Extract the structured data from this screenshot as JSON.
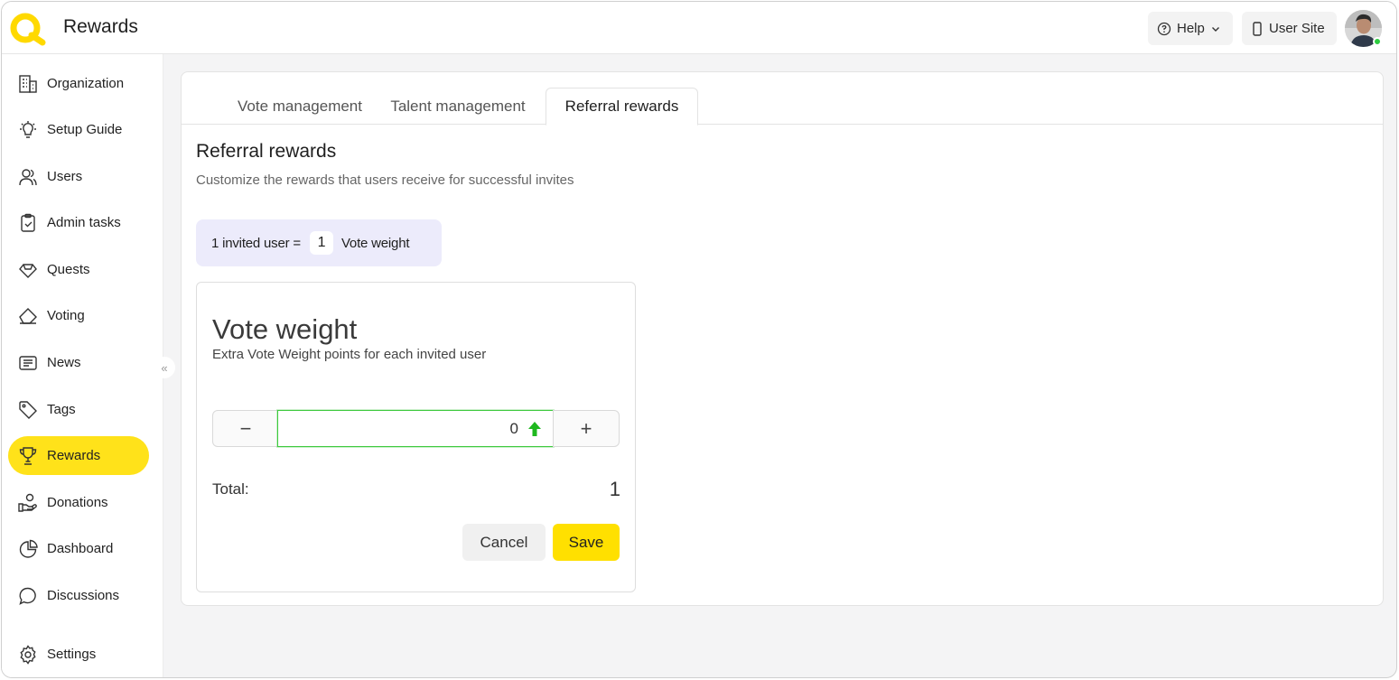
{
  "header": {
    "title": "Rewards",
    "help_label": "Help",
    "user_site_label": "User Site"
  },
  "sidebar": {
    "items": [
      {
        "label": "Organization",
        "icon": "building-icon"
      },
      {
        "label": "Setup Guide",
        "icon": "lightbulb-icon"
      },
      {
        "label": "Users",
        "icon": "users-icon"
      },
      {
        "label": "Admin tasks",
        "icon": "clipboard-check-icon"
      },
      {
        "label": "Quests",
        "icon": "diamond-icon"
      },
      {
        "label": "Voting",
        "icon": "eraser-icon"
      },
      {
        "label": "News",
        "icon": "newspaper-icon"
      },
      {
        "label": "Tags",
        "icon": "tag-icon"
      },
      {
        "label": "Rewards",
        "icon": "trophy-icon",
        "active": true
      },
      {
        "label": "Donations",
        "icon": "hand-heart-icon"
      },
      {
        "label": "Dashboard",
        "icon": "pie-chart-icon"
      },
      {
        "label": "Discussions",
        "icon": "chat-bubble-icon"
      }
    ],
    "settings_label": "Settings",
    "collapse_glyph": "«"
  },
  "tabs": [
    {
      "label": "Vote management",
      "active": false
    },
    {
      "label": "Talent management",
      "active": false
    },
    {
      "label": "Referral rewards",
      "active": true
    }
  ],
  "section": {
    "title": "Referral rewards",
    "subtitle": "Customize the rewards that users receive for successful invites"
  },
  "formula": {
    "prefix": "1 invited user =",
    "value": "1",
    "suffix": "Vote weight"
  },
  "vote_weight": {
    "title": "Vote weight",
    "subtitle": "Extra Vote Weight points for each invited user",
    "minus": "−",
    "plus": "+",
    "input_value": "0",
    "total_label": "Total:",
    "total_value": "1"
  },
  "actions": {
    "cancel_label": "Cancel",
    "save_label": "Save"
  },
  "colors": {
    "accent": "#ffe000",
    "active_nav": "#ffe21a",
    "formula_bg": "#ecebfb",
    "focus_border": "#3cc93c",
    "status_online": "#2ecc40"
  }
}
